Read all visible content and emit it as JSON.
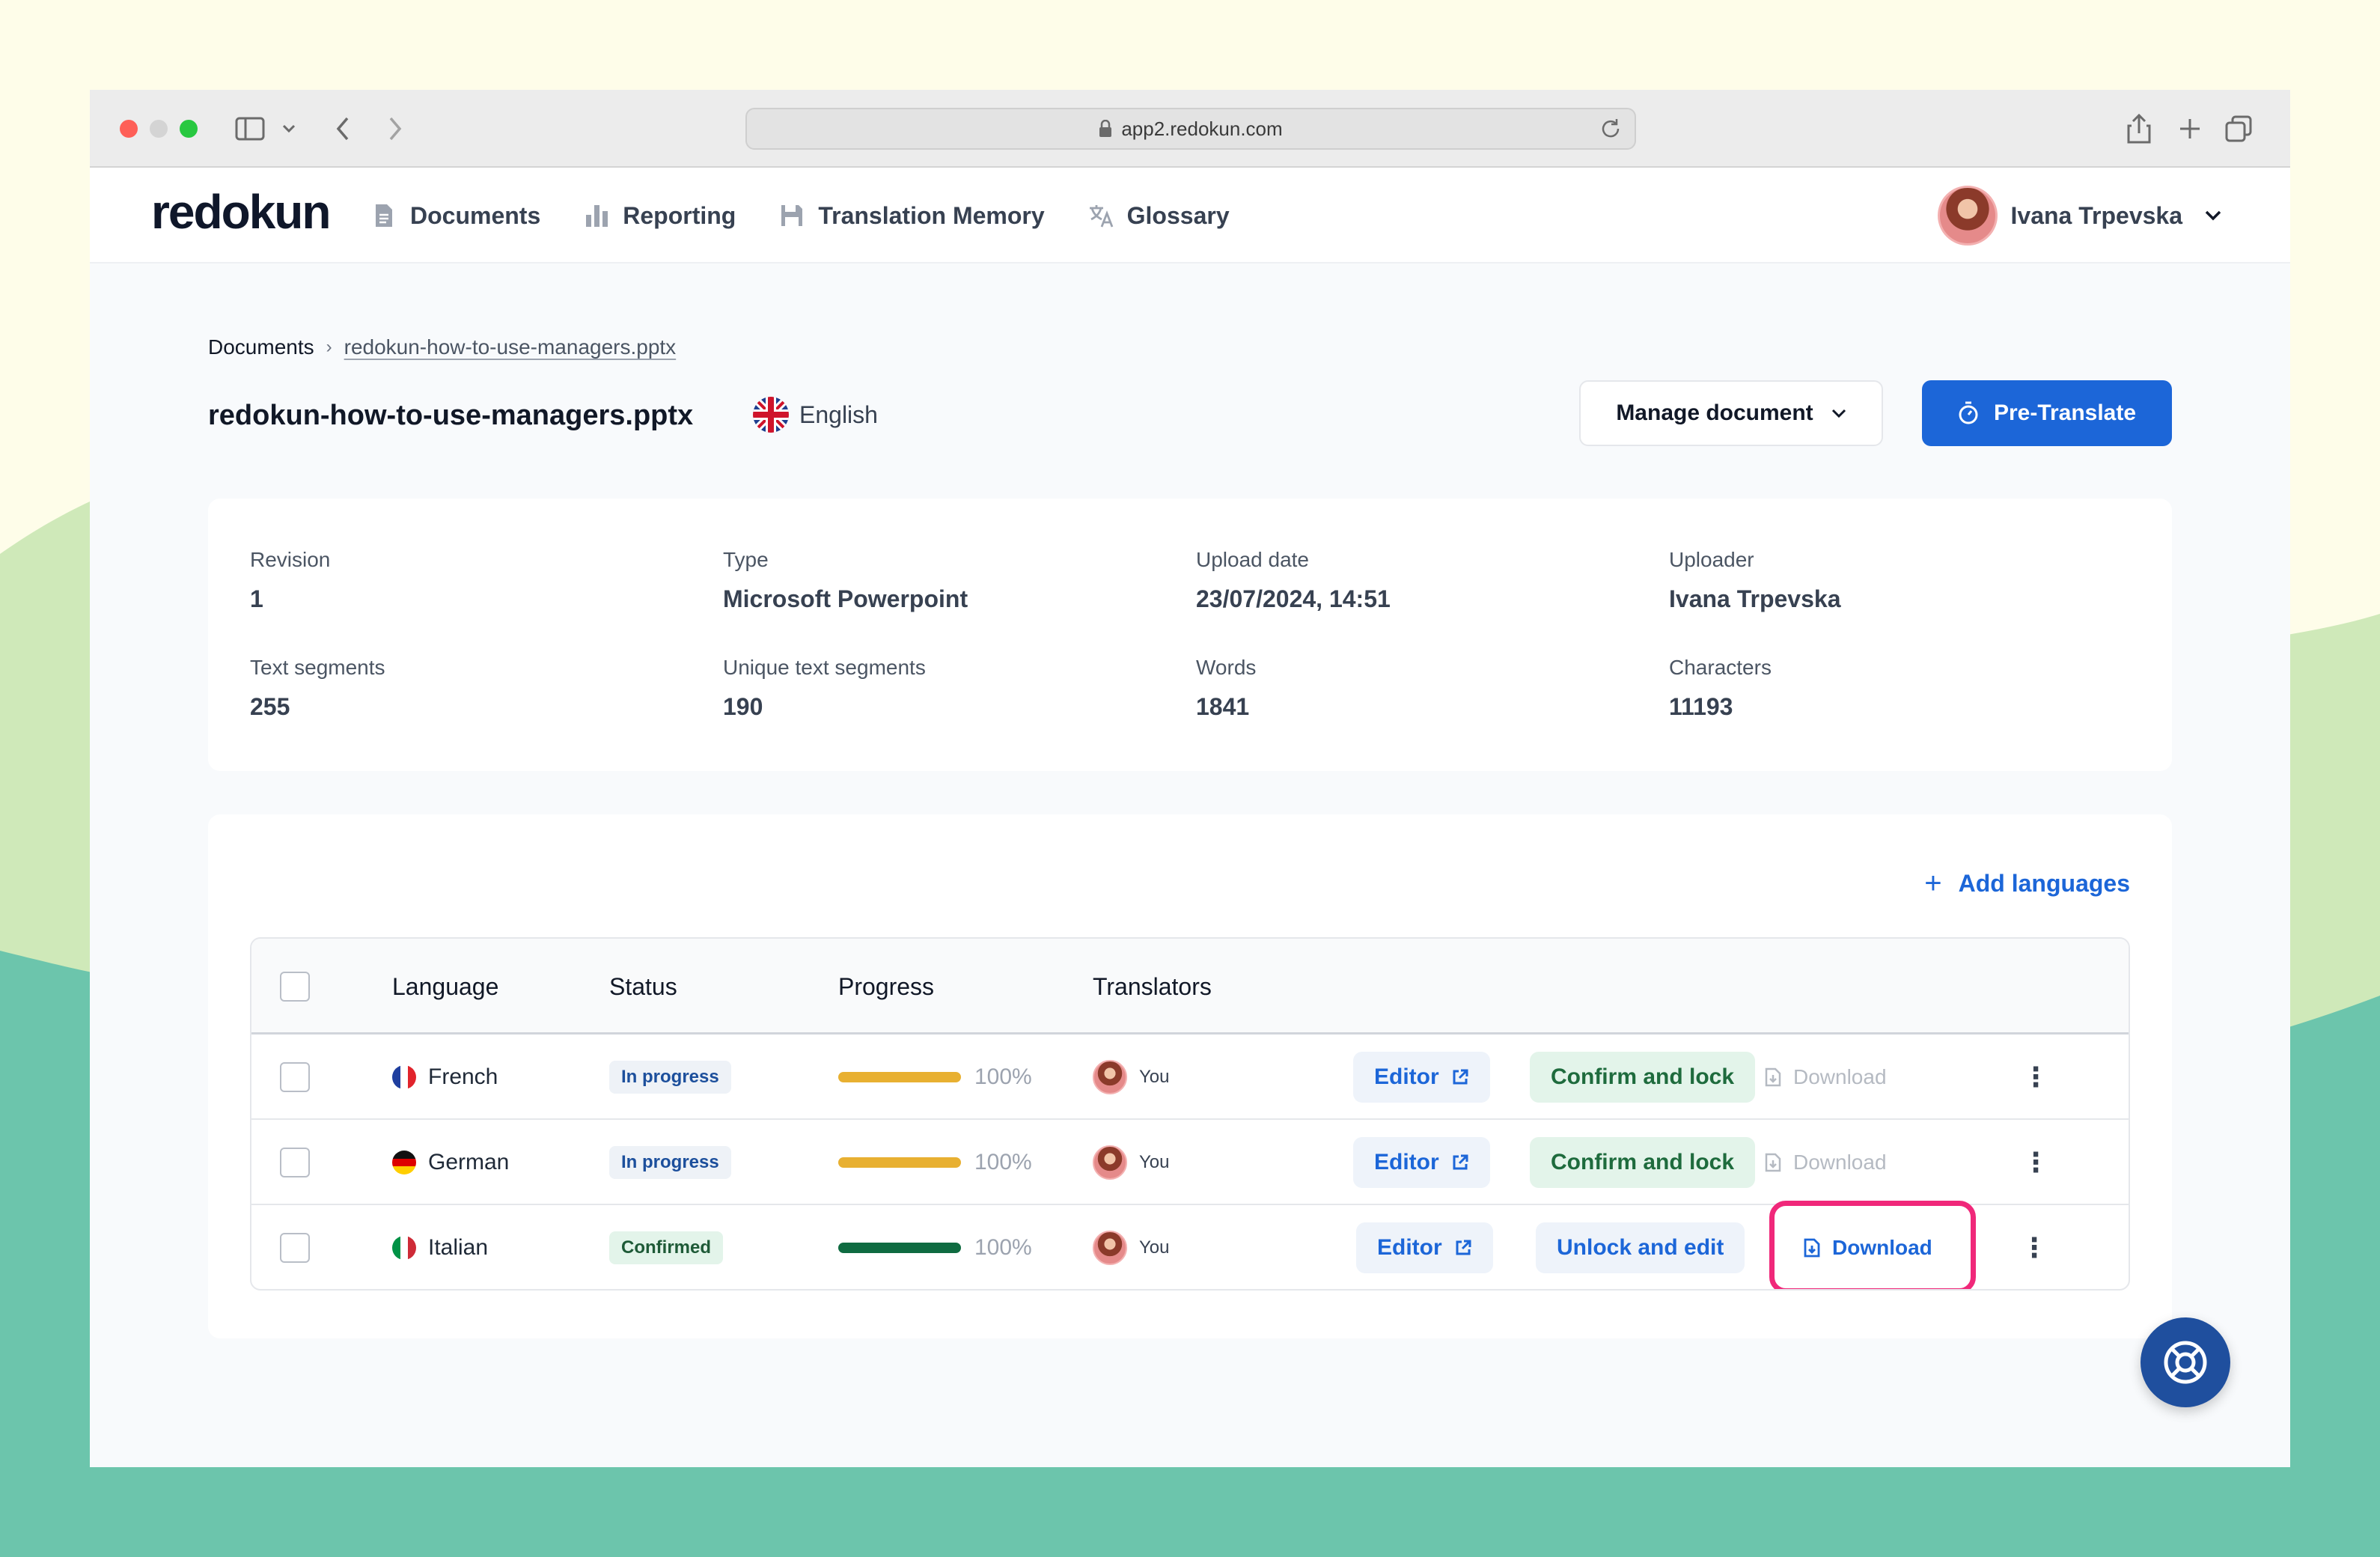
{
  "browser": {
    "url": "app2.redokun.com"
  },
  "app": {
    "logo": "redokun",
    "nav": [
      {
        "label": "Documents",
        "icon": "document-icon"
      },
      {
        "label": "Reporting",
        "icon": "bar-chart-icon"
      },
      {
        "label": "Translation Memory",
        "icon": "save-icon"
      },
      {
        "label": "Glossary",
        "icon": "translate-icon"
      }
    ],
    "user": {
      "name": "Ivana Trpevska"
    }
  },
  "breadcrumb": {
    "root": "Documents",
    "current": "redokun-how-to-use-managers.pptx"
  },
  "document": {
    "title": "redokun-how-to-use-managers.pptx",
    "source_language": "English",
    "manage_label": "Manage document",
    "pretranslate_label": "Pre-Translate"
  },
  "info": {
    "revision_label": "Revision",
    "revision": "1",
    "type_label": "Type",
    "type": "Microsoft Powerpoint",
    "upload_label": "Upload date",
    "upload": "23/07/2024, 14:51",
    "uploader_label": "Uploader",
    "uploader": "Ivana Trpevska",
    "segments_label": "Text segments",
    "segments": "255",
    "unique_label": "Unique text segments",
    "unique": "190",
    "words_label": "Words",
    "words": "1841",
    "chars_label": "Characters",
    "chars": "11193"
  },
  "languages": {
    "add_label": "Add languages",
    "headers": {
      "language": "Language",
      "status": "Status",
      "progress": "Progress",
      "translators": "Translators"
    },
    "rows": [
      {
        "language": "French",
        "status": "In progress",
        "progress_label": "100%",
        "progress": 1.0,
        "translator": "You",
        "editor": "Editor",
        "action": "Confirm and lock",
        "download": "Download"
      },
      {
        "language": "German",
        "status": "In progress",
        "progress_label": "100%",
        "progress": 1.0,
        "translator": "You",
        "editor": "Editor",
        "action": "Confirm and lock",
        "download": "Download"
      },
      {
        "language": "Italian",
        "status": "Confirmed",
        "progress_label": "100%",
        "progress": 1.0,
        "translator": "You",
        "editor": "Editor",
        "action": "Unlock and edit",
        "download": "Download"
      }
    ]
  },
  "colors": {
    "primary": "#1c66d8",
    "progress_in_progress": "#e8b031",
    "progress_confirmed": "#0f6b41",
    "highlight": "#f0287a"
  }
}
